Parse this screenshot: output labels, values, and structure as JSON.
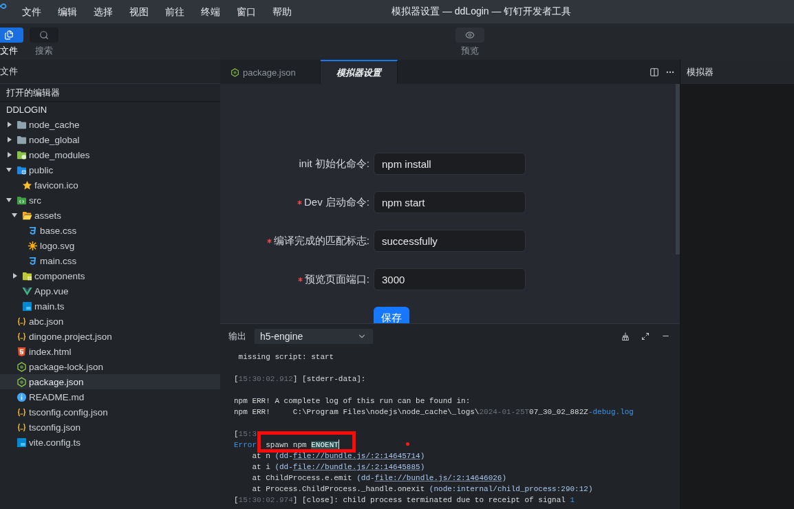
{
  "menu_bar": {
    "items": [
      "文件",
      "编辑",
      "选择",
      "视图",
      "前往",
      "终端",
      "窗口",
      "帮助"
    ],
    "title": "模拟器设置 — ddLogin — 钉钉开发者工具"
  },
  "toolbar": {
    "tools": [
      {
        "kind": "files",
        "label": "文件",
        "selected": true
      },
      {
        "kind": "search",
        "label": "搜索",
        "selected": false
      },
      {
        "kind": "preview",
        "label": "预览",
        "selected": false
      }
    ]
  },
  "sidebar": {
    "title": "文件",
    "open_editors": "打开的编辑器",
    "project": "DDLOGIN",
    "tree": [
      {
        "name": "node_cache",
        "kind": "folder",
        "expanded": false,
        "selected": false
      },
      {
        "name": "node_global",
        "kind": "folder",
        "expanded": false,
        "selected": false
      },
      {
        "name": "node_modules",
        "kind": "modules",
        "expanded": false,
        "selected": false
      },
      {
        "name": "public",
        "kind": "public",
        "expanded": true,
        "selected": false,
        "children": [
          {
            "name": "favicon.ico",
            "kind": "favicon",
            "selected": false
          }
        ]
      },
      {
        "name": "src",
        "kind": "src",
        "expanded": true,
        "selected": false,
        "children": [
          {
            "name": "assets",
            "kind": "assets",
            "expanded": true,
            "selected": false,
            "children": [
              {
                "name": "base.css",
                "kind": "css",
                "selected": false
              },
              {
                "name": "logo.svg",
                "kind": "image",
                "selected": false
              },
              {
                "name": "main.css",
                "kind": "css",
                "selected": false
              }
            ]
          },
          {
            "name": "components",
            "kind": "components",
            "expanded": false,
            "selected": false
          },
          {
            "name": "App.vue",
            "kind": "vue",
            "selected": false
          },
          {
            "name": "main.ts",
            "kind": "typescript",
            "selected": false
          }
        ]
      },
      {
        "name": "abc.json",
        "kind": "json",
        "selected": false
      },
      {
        "name": "dingone.project.json",
        "kind": "json",
        "selected": false
      },
      {
        "name": "index.html",
        "kind": "html",
        "selected": false
      },
      {
        "name": "package-lock.json",
        "kind": "node",
        "selected": false
      },
      {
        "name": "package.json",
        "kind": "node",
        "selected": true
      },
      {
        "name": "README.md",
        "kind": "info",
        "selected": false
      },
      {
        "name": "tsconfig.config.json",
        "kind": "json",
        "selected": false
      },
      {
        "name": "tsconfig.json",
        "kind": "json",
        "selected": false
      },
      {
        "name": "vite.config.ts",
        "kind": "typescript",
        "selected": false
      }
    ]
  },
  "editor": {
    "tabs": [
      {
        "kind": "node",
        "label": "package.json",
        "selected": false
      },
      {
        "kind": "settings",
        "label": "模拟器设置",
        "selected": true
      }
    ],
    "form": {
      "fields": [
        {
          "label": "init 初始化命令:",
          "required": false,
          "value": "npm install"
        },
        {
          "label": "Dev 启动命令:",
          "required": true,
          "value": "npm start"
        },
        {
          "label": "编译完成的匹配标志:",
          "required": true,
          "value": "successfully"
        },
        {
          "label": "预览页面端口:",
          "required": true,
          "value": "3000"
        }
      ],
      "submit": "保存"
    }
  },
  "output": {
    "title": "输出",
    "channel": "h5-engine",
    "blocks": [
      [
        [
          {
            "text": " missing script: start",
            "kind": "plain"
          }
        ]
      ],
      [
        [
          {
            "text": "[",
            "kind": "plain"
          },
          {
            "text": "15:30:02.912",
            "kind": "dim"
          },
          {
            "text": "] [stderr-data]:",
            "kind": "plain"
          }
        ]
      ],
      [
        [
          {
            "text": "npm ERR! A complete log of this run can be found in:",
            "kind": "plain"
          }
        ],
        [
          {
            "text": "npm ERR!     C:\\Program Files\\nodejs\\node_cache\\_logs\\",
            "kind": "plain"
          },
          {
            "text": "2024-01-25T",
            "kind": "dim"
          },
          {
            "text": "07_30_02_882Z",
            "kind": "plain"
          },
          {
            "text": "-debug.log",
            "kind": "keyword"
          }
        ]
      ],
      [
        [
          {
            "text": "[",
            "kind": "plain"
          },
          {
            "text": "15:3",
            "kind": "dim"
          }
        ],
        [
          {
            "text": "Error",
            "kind": "keyword"
          },
          {
            "text": "  spawn npm ",
            "kind": "plain"
          },
          {
            "text": "ENOENT",
            "kind": "match"
          }
        ],
        [
          {
            "text": "    at n ",
            "kind": "plain"
          },
          {
            "text": "(dd-",
            "kind": "stack"
          },
          {
            "text": "file://bundle.js/:2:14645714",
            "kind": "link"
          },
          {
            "text": ")",
            "kind": "stack"
          }
        ],
        [
          {
            "text": "    at i ",
            "kind": "plain"
          },
          {
            "text": "(dd-",
            "kind": "stack"
          },
          {
            "text": "file://bundle.js/:2:14645885",
            "kind": "link"
          },
          {
            "text": ")",
            "kind": "stack"
          }
        ],
        [
          {
            "text": "    at ChildProcess.e.emit ",
            "kind": "plain"
          },
          {
            "text": "(dd-",
            "kind": "stack"
          },
          {
            "text": "file://bundle.js/:2:14646026",
            "kind": "link"
          },
          {
            "text": ")",
            "kind": "stack"
          }
        ],
        [
          {
            "text": "    at Process.ChildProcess._handle.onexit ",
            "kind": "plain"
          },
          {
            "text": "(node:internal/child_process:290:12)",
            "kind": "stack"
          }
        ],
        [
          {
            "text": "[",
            "kind": "plain"
          },
          {
            "text": "15:30:02.974",
            "kind": "dim"
          },
          {
            "text": "] [close]: child process terminated due to receipt of signal ",
            "kind": "plain"
          },
          {
            "text": "1",
            "kind": "keyword"
          }
        ]
      ]
    ],
    "highlight_frame": true,
    "marker_dot": true
  },
  "simulator": {
    "title": "模拟器"
  }
}
